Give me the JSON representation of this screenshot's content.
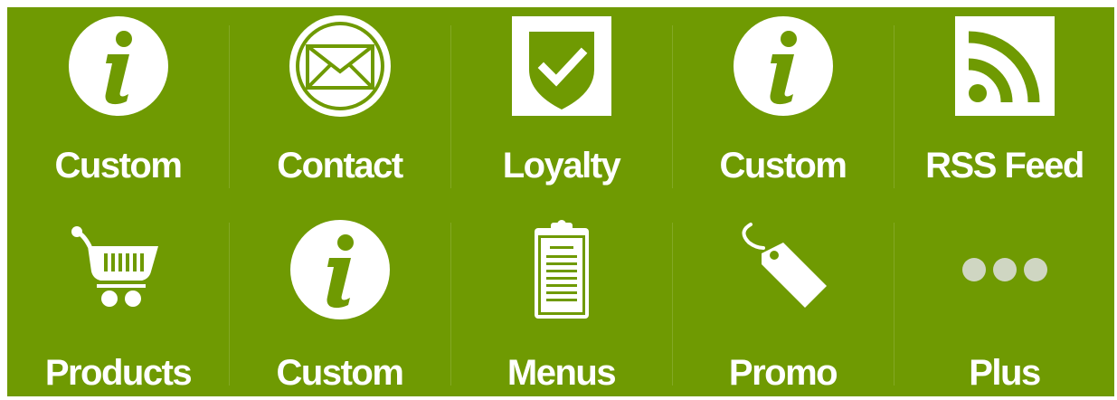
{
  "colors": {
    "panel": "#6f9a02",
    "icon": "#ffffff",
    "plus_dots": "#cfd6c2"
  },
  "tiles": [
    {
      "label": "Custom",
      "icon": "info-icon"
    },
    {
      "label": "Contact",
      "icon": "envelope-icon"
    },
    {
      "label": "Loyalty",
      "icon": "shield-check-icon"
    },
    {
      "label": "Custom",
      "icon": "info-icon"
    },
    {
      "label": "RSS Feed",
      "icon": "rss-icon"
    },
    {
      "label": "Products",
      "icon": "shopping-cart-icon"
    },
    {
      "label": "Custom",
      "icon": "info-icon"
    },
    {
      "label": "Menus",
      "icon": "clipboard-icon"
    },
    {
      "label": "Promo",
      "icon": "tag-icon"
    },
    {
      "label": "Plus",
      "icon": "more-dots-icon"
    }
  ]
}
